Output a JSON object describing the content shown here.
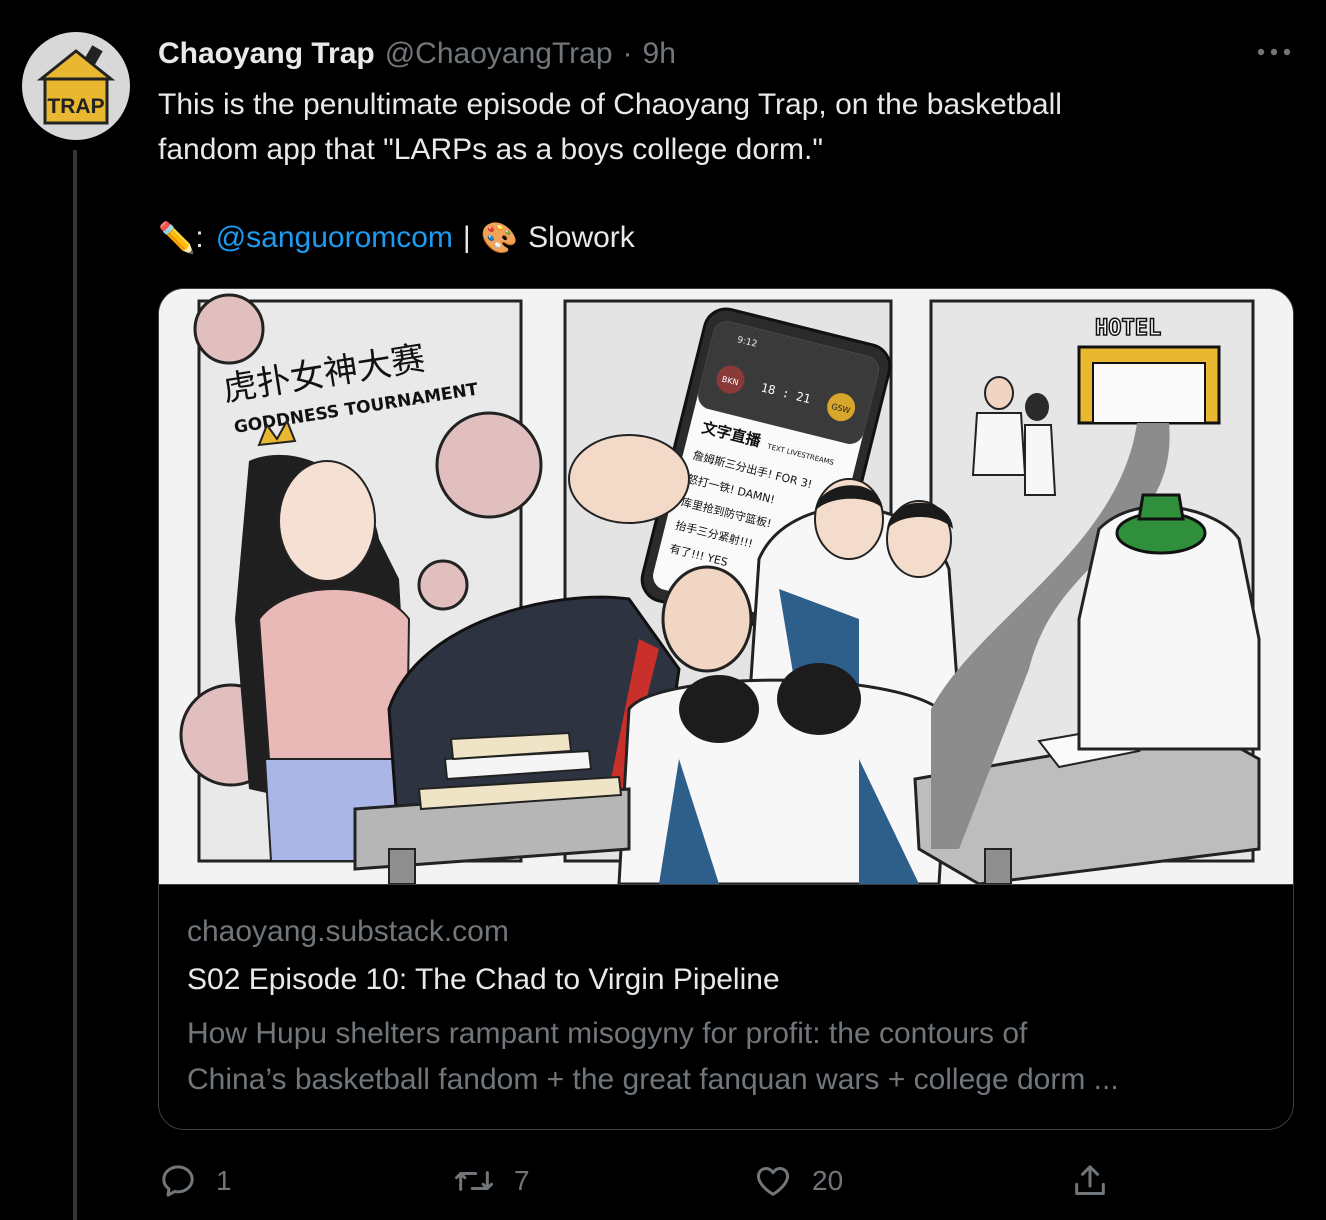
{
  "tweet": {
    "display_name": "Chaoyang Trap",
    "handle": "@ChaoyangTrap",
    "separator": "·",
    "time": "9h",
    "avatar_text": "TRAP",
    "text_lines": [
      "This is the penultimate episode of Chaoyang Trap, on the basketball",
      "fandom app that \"LARPs as a boys college dorm.\""
    ],
    "credit": {
      "pencil_emoji": "✏️",
      "colon": ":",
      "mention": "@sanguoromcom",
      "divider": "|",
      "palette_emoji": "🎨",
      "artist": "Slowork"
    }
  },
  "card": {
    "domain": "chaoyang.substack.com",
    "title": "S02 Episode 10: The Chad to Virgin Pipeline",
    "description_lines": [
      "How Hupu shelters rampant misogyny for profit: the contours of",
      "China’s basketball fandom + the great fanquan wars + college dorm ..."
    ],
    "image_text": {
      "panel1_chinese": "虎扑女神大赛",
      "panel1_english": "GODDNESS TOURNAMENT",
      "phone_time": "9:12",
      "score_time": "18 : 21",
      "team_left": "BKN",
      "team_right": "GSW",
      "livestream_chinese": "文字直播",
      "livestream_english": "TEXT LIVESTREAMS",
      "feed": [
        "詹姆斯三分出手! FOR 3!",
        "怒打一铁! DAMN!",
        "库里抢到防守篮板!",
        "抬手三分紧射!!!",
        "有了!!! YES"
      ],
      "hotel_sign": "HOTEL"
    }
  },
  "actions": {
    "reply_count": "1",
    "retweet_count": "7",
    "like_count": "20"
  },
  "colors": {
    "background": "#000000",
    "text": "#e7e9ea",
    "muted": "#71767b",
    "link": "#1d9bf0",
    "border": "#3a3d40"
  }
}
